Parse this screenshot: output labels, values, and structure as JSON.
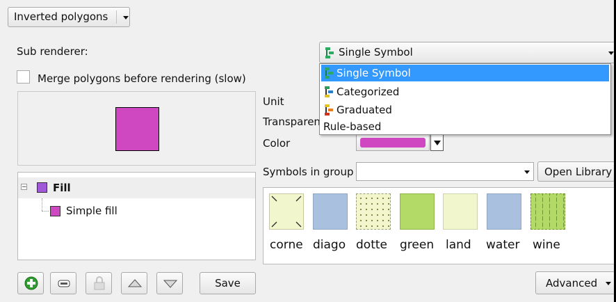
{
  "renderer": {
    "selected": "Inverted polygons"
  },
  "sub_renderer": {
    "label": "Sub renderer:",
    "selected": "Single Symbol"
  },
  "merge_checkbox": {
    "label": "Merge polygons before rendering (slow)",
    "checked": false
  },
  "symbol_preview": {
    "fill_color": "#d048c1"
  },
  "layer_tree": {
    "items": [
      {
        "label": "Fill",
        "swatch": "#a158d8",
        "bold": true
      },
      {
        "label": "Simple fill",
        "swatch": "#d048c1",
        "bold": false
      }
    ]
  },
  "properties": {
    "unit_label": "Unit",
    "transparency_label": "Transparen",
    "color_label": "Color",
    "color_value": "#d048c1"
  },
  "symbols_group": {
    "label": "Symbols in group",
    "value": "",
    "open_library": "Open Library"
  },
  "symbols": [
    {
      "name": "corner",
      "shown": "corne",
      "color": "#f2f6cd",
      "style": "corner"
    },
    {
      "name": "diagonal",
      "shown": "diago",
      "color": "#a9c1de",
      "style": "plain"
    },
    {
      "name": "dotted",
      "shown": "dotte",
      "color": "#f2f6cd",
      "style": "dotted"
    },
    {
      "name": "green",
      "shown": "green",
      "color": "#b3da66",
      "style": "plain"
    },
    {
      "name": "land",
      "shown": "land",
      "color": "#f2f6cd",
      "style": "plain"
    },
    {
      "name": "water",
      "shown": "water",
      "color": "#a9c1de",
      "style": "plain"
    },
    {
      "name": "wine",
      "shown": "wine",
      "color": "#b3da66",
      "style": "wine"
    }
  ],
  "dropdown": {
    "options": [
      {
        "label": "Single Symbol",
        "icon": "single-symbol-icon",
        "highlighted": true
      },
      {
        "label": "Categorized",
        "icon": "categorized-icon",
        "highlighted": false
      },
      {
        "label": "Graduated",
        "icon": "graduated-icon",
        "highlighted": false
      },
      {
        "label": "Rule-based",
        "icon": "",
        "highlighted": false
      }
    ],
    "highlight_color": "#3399ff"
  },
  "toolbar": {
    "save_label": "Save"
  },
  "advanced": {
    "label": "Advanced"
  }
}
